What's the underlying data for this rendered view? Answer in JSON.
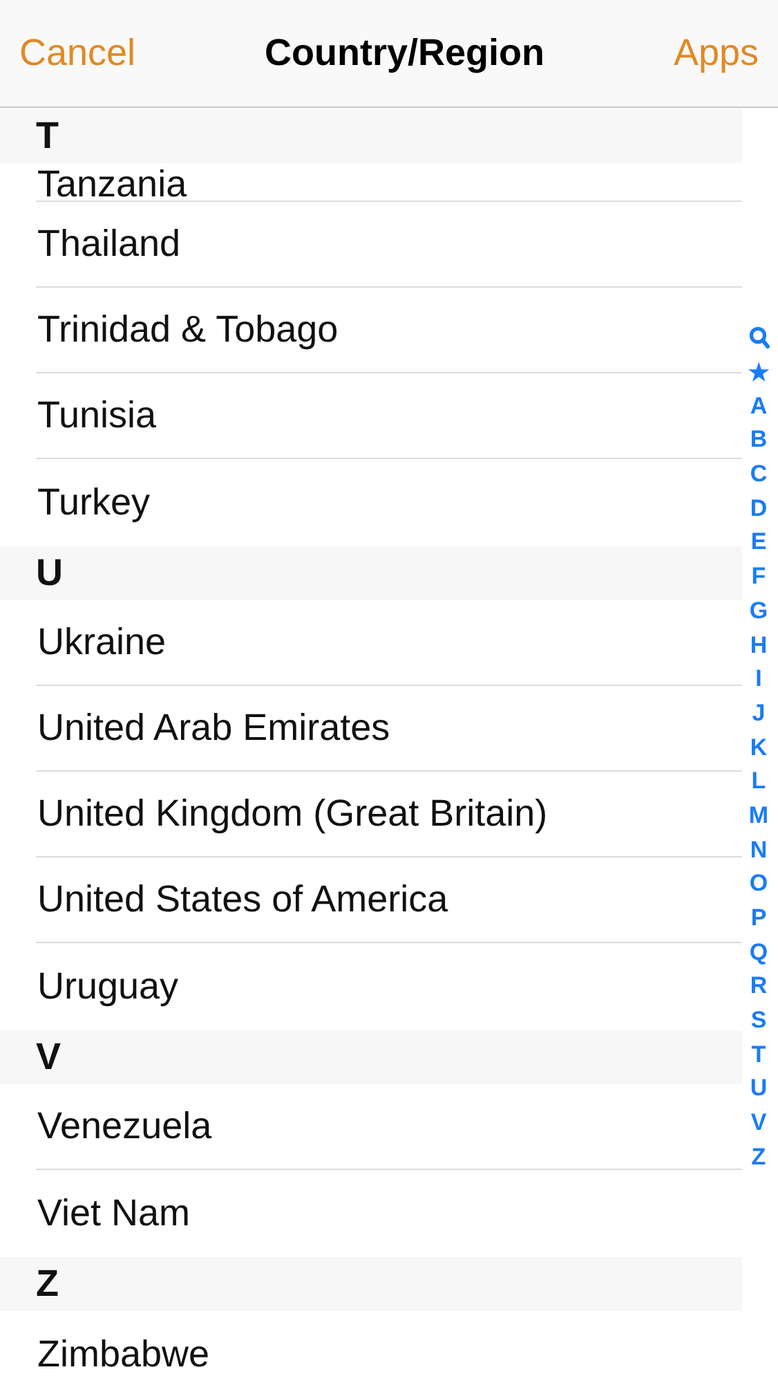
{
  "nav": {
    "left": "Cancel",
    "title": "Country/Region",
    "right": "Apps"
  },
  "partial_row": "Tanzania",
  "sections": [
    {
      "letter": "T",
      "rows": [
        "Thailand",
        "Trinidad & Tobago",
        "Tunisia",
        "Turkey"
      ]
    },
    {
      "letter": "U",
      "rows": [
        "Ukraine",
        "United Arab Emirates",
        "United Kingdom (Great Britain)",
        "United States of America",
        "Uruguay"
      ]
    },
    {
      "letter": "V",
      "rows": [
        "Venezuela",
        "Viet Nam"
      ]
    },
    {
      "letter": "Z",
      "rows": [
        "Zimbabwe"
      ]
    }
  ],
  "index": [
    {
      "kind": "search"
    },
    {
      "kind": "text",
      "label": "★"
    },
    {
      "kind": "text",
      "label": "A"
    },
    {
      "kind": "text",
      "label": "B"
    },
    {
      "kind": "text",
      "label": "C"
    },
    {
      "kind": "text",
      "label": "D"
    },
    {
      "kind": "text",
      "label": "E"
    },
    {
      "kind": "text",
      "label": "F"
    },
    {
      "kind": "text",
      "label": "G"
    },
    {
      "kind": "text",
      "label": "H"
    },
    {
      "kind": "text",
      "label": "I"
    },
    {
      "kind": "text",
      "label": "J"
    },
    {
      "kind": "text",
      "label": "K"
    },
    {
      "kind": "text",
      "label": "L"
    },
    {
      "kind": "text",
      "label": "M"
    },
    {
      "kind": "text",
      "label": "N"
    },
    {
      "kind": "text",
      "label": "O"
    },
    {
      "kind": "text",
      "label": "P"
    },
    {
      "kind": "text",
      "label": "Q"
    },
    {
      "kind": "text",
      "label": "R"
    },
    {
      "kind": "text",
      "label": "S"
    },
    {
      "kind": "text",
      "label": "T"
    },
    {
      "kind": "text",
      "label": "U"
    },
    {
      "kind": "text",
      "label": "V"
    },
    {
      "kind": "text",
      "label": "Z"
    }
  ]
}
